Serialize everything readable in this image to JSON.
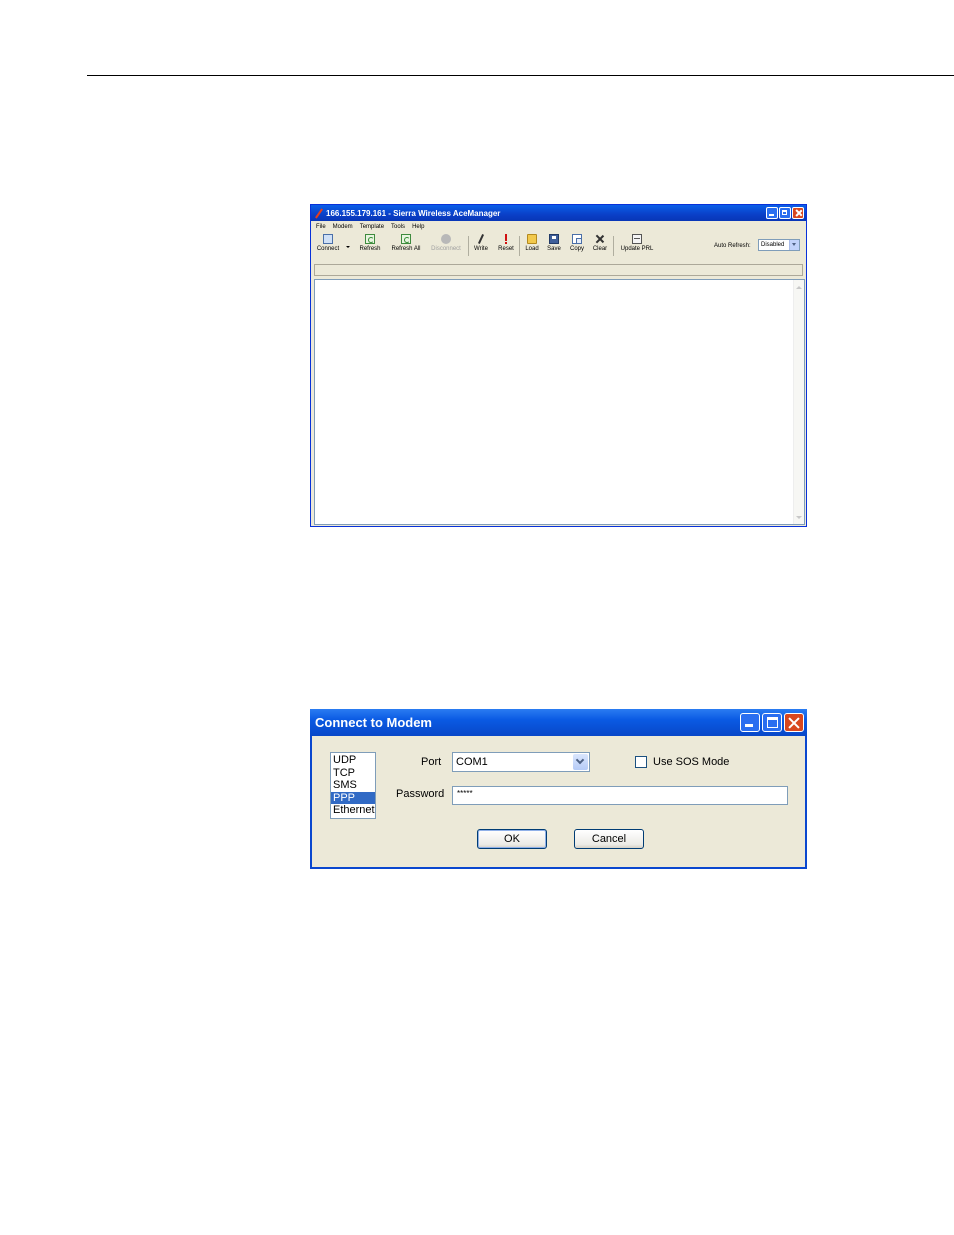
{
  "acemanager": {
    "title": "166.155.179.161 - Sierra Wireless AceManager",
    "menu": [
      "File",
      "Modem",
      "Template",
      "Tools",
      "Help"
    ],
    "toolbar": {
      "connect": "Connect",
      "refresh": "Refresh",
      "refresh_all": "Refresh All",
      "disconnect": "Disconnect",
      "write": "Write",
      "reset": "Reset",
      "load": "Load",
      "save": "Save",
      "copy": "Copy",
      "clear": "Clear",
      "update_prl": "Update PRL",
      "auto_refresh_label": "Auto Refresh:",
      "auto_refresh_value": "Disabled"
    }
  },
  "connect_dialog": {
    "title": "Connect to Modem",
    "protocols": [
      "UDP",
      "TCP",
      "SMS",
      "PPP",
      "Ethernet"
    ],
    "selected_protocol": "PPP",
    "port_label": "Port",
    "port_value": "COM1",
    "sos_label": "Use SOS Mode",
    "password_label": "Password",
    "password_value": "*****",
    "ok_label": "OK",
    "cancel_label": "Cancel"
  }
}
